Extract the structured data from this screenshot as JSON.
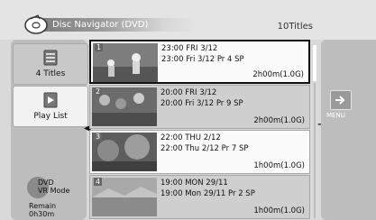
{
  "header": {
    "title": "Disc Navigator (DVD)",
    "titles_count": "10Titles"
  },
  "left_panel": {
    "buttons": [
      {
        "label": "4 Titles",
        "icon": "list-icon"
      },
      {
        "label": "Play List",
        "icon": "playlist-icon"
      }
    ],
    "mode_line1": "DVD",
    "mode_line2": "VR Mode",
    "remain_label": "Remain",
    "remain_value": "0h30m"
  },
  "titles": [
    {
      "num": "1",
      "line1": "23:00 FRI 3/12",
      "line2": "23:00  Fri  3/12  Pr 4  SP",
      "duration": "2h00m(1.0G)"
    },
    {
      "num": "2",
      "line1": "20:00 FRI 3/12",
      "line2": "20:00  Fri  3/12  Pr 9  SP",
      "duration": "2h00m(1.0G)"
    },
    {
      "num": "3",
      "line1": "22:00 THU 2/12",
      "line2": "22:00  Thu  2/12  Pr 7  SP",
      "duration": "1h00m(1.0G)"
    },
    {
      "num": "4",
      "line1": "19:00 MON 29/11",
      "line2": "19:00  Mon  29/11  Pr 2  SP",
      "duration": "1h00m(1.0G)"
    }
  ],
  "right_panel": {
    "menu_label": "MENU"
  }
}
